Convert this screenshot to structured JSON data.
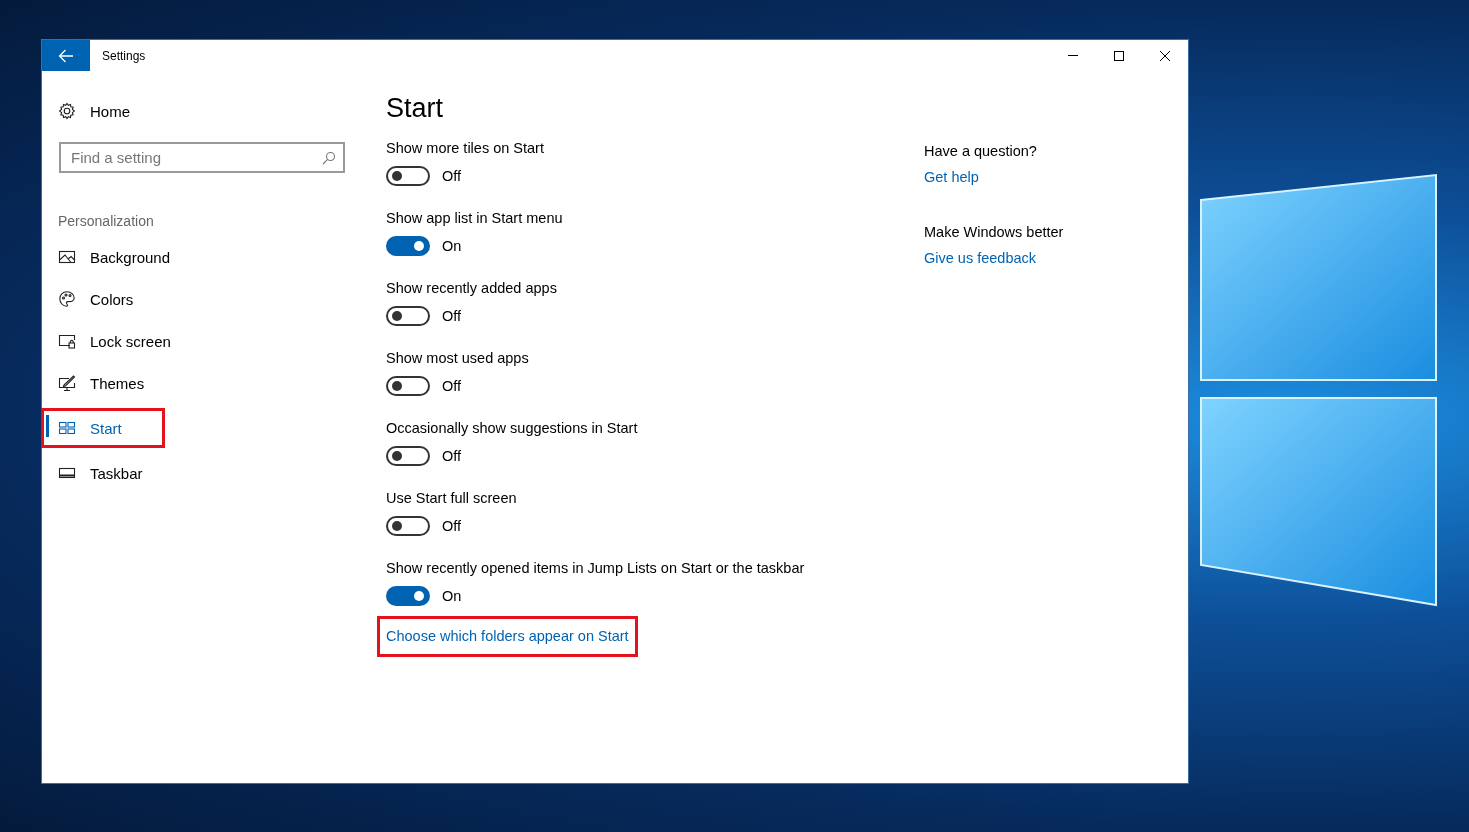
{
  "window": {
    "title": "Settings"
  },
  "sidebar": {
    "home": "Home",
    "search": {
      "placeholder": "Find a setting"
    },
    "section": "Personalization",
    "items": [
      {
        "label": "Background",
        "selected": false,
        "highlighted": false
      },
      {
        "label": "Colors",
        "selected": false,
        "highlighted": false
      },
      {
        "label": "Lock screen",
        "selected": false,
        "highlighted": false
      },
      {
        "label": "Themes",
        "selected": false,
        "highlighted": false
      },
      {
        "label": "Start",
        "selected": true,
        "highlighted": true
      },
      {
        "label": "Taskbar",
        "selected": false,
        "highlighted": false
      }
    ]
  },
  "page": {
    "title": "Start",
    "settings": [
      {
        "label": "Show more tiles on Start",
        "on": false,
        "state_text": "Off"
      },
      {
        "label": "Show app list in Start menu",
        "on": true,
        "state_text": "On"
      },
      {
        "label": "Show recently added apps",
        "on": false,
        "state_text": "Off"
      },
      {
        "label": "Show most used apps",
        "on": false,
        "state_text": "Off"
      },
      {
        "label": "Occasionally show suggestions in Start",
        "on": false,
        "state_text": "Off"
      },
      {
        "label": "Use Start full screen",
        "on": false,
        "state_text": "Off"
      },
      {
        "label": "Show recently opened items in Jump Lists on Start or the taskbar",
        "on": true,
        "state_text": "On"
      }
    ],
    "link": {
      "label": "Choose which folders appear on Start",
      "highlighted": true
    }
  },
  "aside": [
    {
      "heading": "Have a question?",
      "link": "Get help"
    },
    {
      "heading": "Make Windows better",
      "link": "Give us feedback"
    }
  ]
}
